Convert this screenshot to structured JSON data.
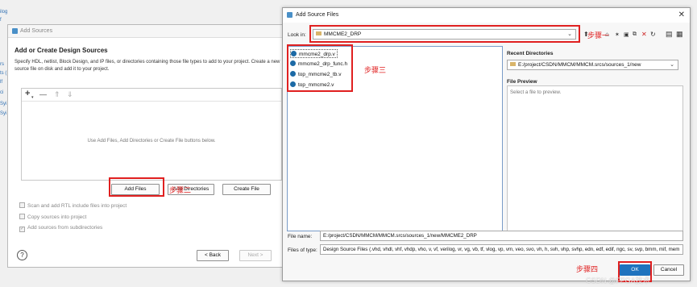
{
  "background": {
    "items": [
      "ilog",
      "f",
      "rs",
      "ts (",
      "lf",
      "ci",
      "Syi",
      "Syi"
    ]
  },
  "add_sources": {
    "title": "Add Sources",
    "heading": "Add or Create Design Sources",
    "description": "Specify HDL, netlist, Block Design, and IP files, or directories containing those file types to add to your project. Create a new source file on disk and add it to your project.",
    "empty_message": "Use Add Files, Add Directories or Create File buttons below.",
    "buttons": {
      "add_files": "Add Files",
      "add_directories": "Add Directories",
      "create_file": "Create File",
      "back": "< Back",
      "next": "Next >"
    },
    "checkboxes": [
      {
        "label": "Scan and add RTL include files into project",
        "checked": false
      },
      {
        "label": "Copy sources into project",
        "checked": false
      },
      {
        "label": "Add sources from subdirectories",
        "checked": true
      }
    ],
    "help": "?"
  },
  "add_source_files": {
    "title": "Add Source Files",
    "look_in_label": "Look in:",
    "look_in_value": "MMCME2_DRP",
    "files": [
      "mmcme2_drp.v",
      "mmcme2_drp_func.h",
      "top_mmcme2_tb.v",
      "top_mmcme2.v"
    ],
    "recent_label": "Recent Directories",
    "recent_value": "E:/project/CSDN/MMCM/MMCM.srcs/sources_1/new",
    "preview_label": "File Preview",
    "preview_placeholder": "Select a file to preview.",
    "file_name_label": "File name:",
    "file_name_value": "E:/project/CSDN/MMCM/MMCM.srcs/sources_1/new/MMCME2_DRP",
    "files_of_type_label": "Files of type:",
    "files_of_type_value": "Design Source Files (.vhd, vhdl, vhf, vhdp, vho, v, vf, verilog, vr, vg, vb, tf, vlog, vp, vm, veo, svo, vh, h, svh, vhp, svhp, edn, edf, edif, ngc, sv, svp, bmm, mif, mem",
    "buttons": {
      "ok": "OK",
      "cancel": "Cancel"
    }
  },
  "annotations": {
    "step1": "步骤一",
    "step2": "步骤二",
    "step3": "步骤三",
    "step4": "步骤四"
  },
  "watermark": "CSDN @FPGA技术",
  "accent_red": "#e02020",
  "accent_blue": "#1c6aa6"
}
